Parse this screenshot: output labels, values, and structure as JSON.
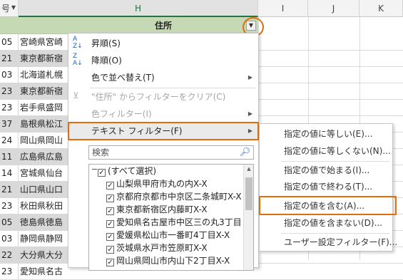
{
  "columns": {
    "left_partial": "号",
    "h": "H",
    "i": "I",
    "j": "J",
    "k": "K"
  },
  "header_row": {
    "address_label": "住所"
  },
  "rows": [
    {
      "num": "05",
      "addr": "宮崎県宮崎"
    },
    {
      "num": "21",
      "addr": "東京都新宿"
    },
    {
      "num": "03",
      "addr": "北海道札幌"
    },
    {
      "num": "23",
      "addr": "東京都新宿"
    },
    {
      "num": "23",
      "addr": "岩手県盛岡"
    },
    {
      "num": "37",
      "addr": "島根県松江"
    },
    {
      "num": "24",
      "addr": "岡山県岡山"
    },
    {
      "num": "11",
      "addr": "広島県広島"
    },
    {
      "num": "14",
      "addr": "宮城県仙台"
    },
    {
      "num": "21",
      "addr": "山口県山口"
    },
    {
      "num": "23",
      "addr": "秋田県秋田"
    },
    {
      "num": "05",
      "addr": "徳島県徳島"
    },
    {
      "num": "03",
      "addr": "静岡県静岡"
    },
    {
      "num": "22",
      "addr": "大分県大分"
    },
    {
      "num": "23",
      "addr": "愛知県名古"
    }
  ],
  "menu": {
    "sort_asc": "昇順(S)",
    "sort_desc": "降順(O)",
    "sort_by_color": "色で並べ替え(T)",
    "clear_filter": "\"住所\" からフィルターをクリア(C)",
    "color_filter": "色フィルター(I)",
    "text_filter": "テキスト フィルター(F)",
    "search_placeholder": "検索",
    "tree_items": [
      "(すべて選択)",
      "山梨県甲府市丸の内X-X",
      "京都府京都市中京区二条城町X-X",
      "東京都新宿区内藤町X-X",
      "愛知県名古屋市中区三の丸3丁目",
      "愛媛県松山市一番町4丁目X-X",
      "茨城県水戸市笠原町X-X",
      "岡山県岡山市内山下2丁目X-X"
    ]
  },
  "submenu": {
    "equals": "指定の値に等しい(E)...",
    "not_equals": "指定の値に等しくない(N)...",
    "begins_with": "指定の値で始まる(I)...",
    "ends_with": "指定の値で終わる(T)...",
    "contains": "指定の値を含む(A)...",
    "not_contains": "指定の値を含まない(D)...",
    "custom": "ユーザー設定フィルター(F)..."
  },
  "icons": {
    "sort_asc": "sort-ascending-icon",
    "sort_desc": "sort-descending-icon",
    "clear_filter": "clear-filter-icon",
    "submenu_arrow": "chevron-right-icon",
    "search": "magnifier-icon",
    "dropdown": "dropdown-arrow-icon"
  },
  "colors": {
    "header_fill": "#c6d9b5",
    "highlight_orange": "#e46c0a",
    "row_shade": "#d9d9d9"
  }
}
